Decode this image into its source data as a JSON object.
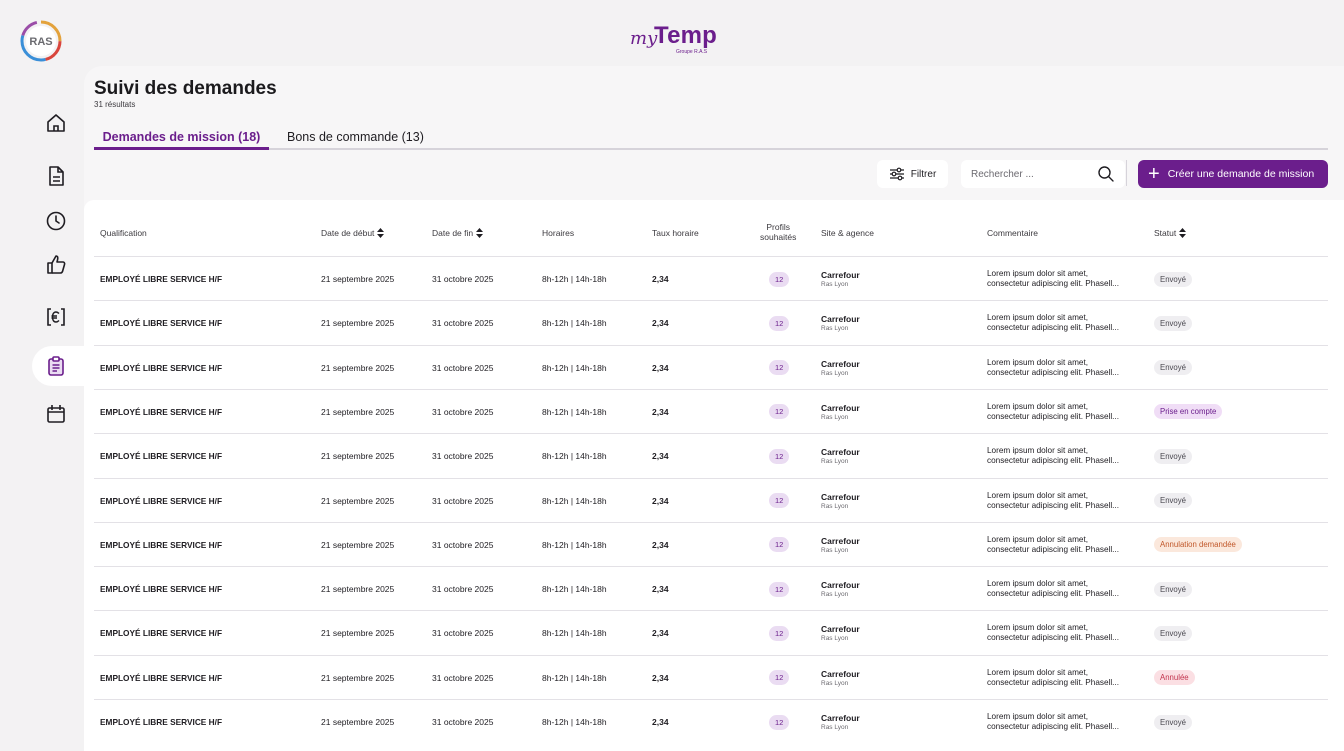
{
  "brand": {
    "logo_text": "RAS",
    "app_my": "my",
    "app_name": "Temp",
    "app_sub": "Groupe R.A.S"
  },
  "sidebar": {
    "items": [
      {
        "icon": "home-icon"
      },
      {
        "icon": "document-icon"
      },
      {
        "icon": "clock-icon"
      },
      {
        "icon": "thumbs-up-icon"
      },
      {
        "icon": "euro-icon"
      },
      {
        "icon": "clipboard-icon",
        "active": true
      },
      {
        "icon": "calendar-icon"
      }
    ]
  },
  "page": {
    "title": "Suivi des demandes",
    "results": "31 résultats"
  },
  "tabs": [
    {
      "label": "Demandes de mission (18)",
      "active": true
    },
    {
      "label": "Bons de commande (13)",
      "active": false
    }
  ],
  "toolbar": {
    "filter_label": "Filtrer",
    "search_placeholder": "Rechercher ...",
    "create_label": "Créer une demande de mission"
  },
  "table": {
    "headers": {
      "qualification": "Qualification",
      "start": "Date de début",
      "end": "Date de fin",
      "hours": "Horaires",
      "rate": "Taux horaire",
      "profiles_1": "Profils",
      "profiles_2": "souhaités",
      "site": "Site & agence",
      "comment": "Commentaire",
      "status": "Statut"
    },
    "rows": [
      {
        "qualification": "EMPLOYÉ LIBRE SERVICE H/F",
        "start": "21 septembre 2025",
        "end": "31 octobre 2025",
        "hours": "8h-12h | 14h-18h",
        "rate": "2,34",
        "profiles": "12",
        "site": "Carrefour",
        "agency": "Ras Lyon",
        "comment_1": "Lorem ipsum dolor sit amet,",
        "comment_2": "consectetur adipiscing elit. Phasell...",
        "status": "Envoyé",
        "status_type": "sent"
      },
      {
        "qualification": "EMPLOYÉ LIBRE SERVICE H/F",
        "start": "21 septembre 2025",
        "end": "31 octobre 2025",
        "hours": "8h-12h | 14h-18h",
        "rate": "2,34",
        "profiles": "12",
        "site": "Carrefour",
        "agency": "Ras Lyon",
        "comment_1": "Lorem ipsum dolor sit amet,",
        "comment_2": "consectetur adipiscing elit. Phasell...",
        "status": "Envoyé",
        "status_type": "sent"
      },
      {
        "qualification": "EMPLOYÉ LIBRE SERVICE H/F",
        "start": "21 septembre 2025",
        "end": "31 octobre 2025",
        "hours": "8h-12h | 14h-18h",
        "rate": "2,34",
        "profiles": "12",
        "site": "Carrefour",
        "agency": "Ras Lyon",
        "comment_1": "Lorem ipsum dolor sit amet,",
        "comment_2": "consectetur adipiscing elit. Phasell...",
        "status": "Envoyé",
        "status_type": "sent"
      },
      {
        "qualification": "EMPLOYÉ LIBRE SERVICE H/F",
        "start": "21 septembre 2025",
        "end": "31 octobre 2025",
        "hours": "8h-12h | 14h-18h",
        "rate": "2,34",
        "profiles": "12",
        "site": "Carrefour",
        "agency": "Ras Lyon",
        "comment_1": "Lorem ipsum dolor sit amet,",
        "comment_2": "consectetur adipiscing elit. Phasell...",
        "status": "Prise en compte",
        "status_type": "taken"
      },
      {
        "qualification": "EMPLOYÉ LIBRE SERVICE H/F",
        "start": "21 septembre 2025",
        "end": "31 octobre 2025",
        "hours": "8h-12h | 14h-18h",
        "rate": "2,34",
        "profiles": "12",
        "site": "Carrefour",
        "agency": "Ras Lyon",
        "comment_1": "Lorem ipsum dolor sit amet,",
        "comment_2": "consectetur adipiscing elit. Phasell...",
        "status": "Envoyé",
        "status_type": "sent"
      },
      {
        "qualification": "EMPLOYÉ LIBRE SERVICE H/F",
        "start": "21 septembre 2025",
        "end": "31 octobre 2025",
        "hours": "8h-12h | 14h-18h",
        "rate": "2,34",
        "profiles": "12",
        "site": "Carrefour",
        "agency": "Ras Lyon",
        "comment_1": "Lorem ipsum dolor sit amet,",
        "comment_2": "consectetur adipiscing elit. Phasell...",
        "status": "Envoyé",
        "status_type": "sent"
      },
      {
        "qualification": "EMPLOYÉ LIBRE SERVICE H/F",
        "start": "21 septembre 2025",
        "end": "31 octobre 2025",
        "hours": "8h-12h | 14h-18h",
        "rate": "2,34",
        "profiles": "12",
        "site": "Carrefour",
        "agency": "Ras Lyon",
        "comment_1": "Lorem ipsum dolor sit amet,",
        "comment_2": "consectetur adipiscing elit. Phasell...",
        "status": "Annulation demandée",
        "status_type": "cancel-req"
      },
      {
        "qualification": "EMPLOYÉ LIBRE SERVICE H/F",
        "start": "21 septembre 2025",
        "end": "31 octobre 2025",
        "hours": "8h-12h | 14h-18h",
        "rate": "2,34",
        "profiles": "12",
        "site": "Carrefour",
        "agency": "Ras Lyon",
        "comment_1": "Lorem ipsum dolor sit amet,",
        "comment_2": "consectetur adipiscing elit. Phasell...",
        "status": "Envoyé",
        "status_type": "sent"
      },
      {
        "qualification": "EMPLOYÉ LIBRE SERVICE H/F",
        "start": "21 septembre 2025",
        "end": "31 octobre 2025",
        "hours": "8h-12h | 14h-18h",
        "rate": "2,34",
        "profiles": "12",
        "site": "Carrefour",
        "agency": "Ras Lyon",
        "comment_1": "Lorem ipsum dolor sit amet,",
        "comment_2": "consectetur adipiscing elit. Phasell...",
        "status": "Envoyé",
        "status_type": "sent"
      },
      {
        "qualification": "EMPLOYÉ LIBRE SERVICE H/F",
        "start": "21 septembre 2025",
        "end": "31 octobre 2025",
        "hours": "8h-12h | 14h-18h",
        "rate": "2,34",
        "profiles": "12",
        "site": "Carrefour",
        "agency": "Ras Lyon",
        "comment_1": "Lorem ipsum dolor sit amet,",
        "comment_2": "consectetur adipiscing elit. Phasell...",
        "status": "Annulée",
        "status_type": "cancelled"
      },
      {
        "qualification": "EMPLOYÉ LIBRE SERVICE H/F",
        "start": "21 septembre 2025",
        "end": "31 octobre 2025",
        "hours": "8h-12h | 14h-18h",
        "rate": "2,34",
        "profiles": "12",
        "site": "Carrefour",
        "agency": "Ras Lyon",
        "comment_1": "Lorem ipsum dolor sit amet,",
        "comment_2": "consectetur adipiscing elit. Phasell...",
        "status": "Envoyé",
        "status_type": "sent"
      }
    ]
  },
  "colors": {
    "accent": "#6b1e8c",
    "accent_light": "#eadcf2"
  }
}
